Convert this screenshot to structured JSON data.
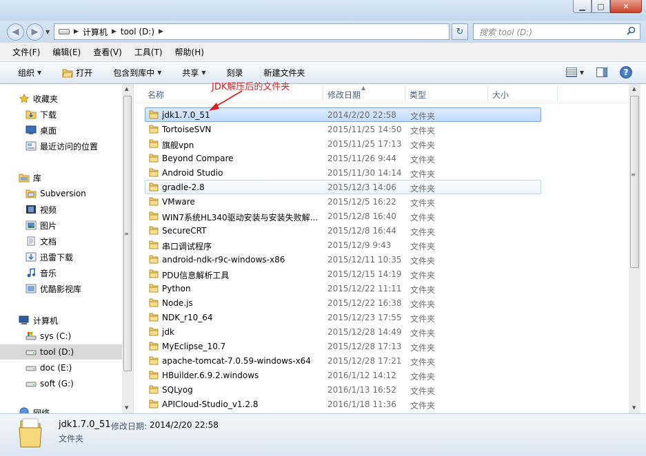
{
  "window": {
    "minimize_glyph": "▁",
    "maximize_glyph": "□",
    "close_glyph": "✕"
  },
  "address": {
    "back_glyph": "◀",
    "forward_glyph": "▶",
    "dropdown_glyph": "▼",
    "refresh_glyph": "↻",
    "breadcrumbs": [
      "计算机",
      "tool (D:)"
    ],
    "separator": "▶",
    "search_placeholder": "搜索 tool (D:)",
    "search_icon": "search-icon"
  },
  "menu": {
    "items": [
      "文件(F)",
      "编辑(E)",
      "查看(V)",
      "工具(T)",
      "帮助(H)"
    ]
  },
  "toolbar": {
    "organize": "组织",
    "open": "打开",
    "include_library": "包含到库中",
    "share": "共享",
    "burn": "刻录",
    "new_folder": "新建文件夹",
    "caret": "▼",
    "help_glyph": "?"
  },
  "nav": {
    "favorites": "收藏夹",
    "downloads": "下载",
    "desktop": "桌面",
    "recent": "最近访问的位置",
    "library": "库",
    "subversion": "Subversion",
    "videos": "视频",
    "pictures": "图片",
    "documents": "文档",
    "xunlei": "迅雷下载",
    "music": "音乐",
    "youku": "优酷影视库",
    "computer": "计算机",
    "drive_c": "sys (C:)",
    "drive_d": "tool (D:)",
    "drive_e": "doc (E:)",
    "drive_g": "soft (G:)",
    "network": "网络"
  },
  "columns": {
    "name": "名称",
    "date": "修改日期",
    "type": "类型",
    "size": "大小"
  },
  "files": [
    {
      "name": "jdk1.7.0_51",
      "date": "2014/2/20 22:58",
      "type": "文件夹",
      "state": "selected"
    },
    {
      "name": "TortoiseSVN",
      "date": "2015/11/25 14:50",
      "type": "文件夹",
      "state": ""
    },
    {
      "name": "旗舰vpn",
      "date": "2015/11/25 17:13",
      "type": "文件夹",
      "state": ""
    },
    {
      "name": "Beyond Compare",
      "date": "2015/11/26 9:44",
      "type": "文件夹",
      "state": ""
    },
    {
      "name": "Android Studio",
      "date": "2015/11/30 14:14",
      "type": "文件夹",
      "state": ""
    },
    {
      "name": "gradle-2.8",
      "date": "2015/12/3 14:06",
      "type": "文件夹",
      "state": "hover"
    },
    {
      "name": "VMware",
      "date": "2015/12/5 16:22",
      "type": "文件夹",
      "state": ""
    },
    {
      "name": "WIN7系统HL340驱动安装与安装失败解...",
      "date": "2015/12/8 16:40",
      "type": "文件夹",
      "state": ""
    },
    {
      "name": "SecureCRT",
      "date": "2015/12/8 16:44",
      "type": "文件夹",
      "state": ""
    },
    {
      "name": "串口调试程序",
      "date": "2015/12/9 9:43",
      "type": "文件夹",
      "state": ""
    },
    {
      "name": "android-ndk-r9c-windows-x86",
      "date": "2015/12/11 10:35",
      "type": "文件夹",
      "state": ""
    },
    {
      "name": "PDU信息解析工具",
      "date": "2015/12/15 14:19",
      "type": "文件夹",
      "state": ""
    },
    {
      "name": "Python",
      "date": "2015/12/22 11:11",
      "type": "文件夹",
      "state": ""
    },
    {
      "name": "Node.js",
      "date": "2015/12/22 16:38",
      "type": "文件夹",
      "state": ""
    },
    {
      "name": "NDK_r10_64",
      "date": "2015/12/23 17:55",
      "type": "文件夹",
      "state": ""
    },
    {
      "name": "jdk",
      "date": "2015/12/28 14:49",
      "type": "文件夹",
      "state": ""
    },
    {
      "name": "MyEclipse_10.7",
      "date": "2015/12/28 17:13",
      "type": "文件夹",
      "state": ""
    },
    {
      "name": "apache-tomcat-7.0.59-windows-x64",
      "date": "2015/12/28 17:21",
      "type": "文件夹",
      "state": ""
    },
    {
      "name": "HBuilder.6.9.2.windows",
      "date": "2016/1/12 14:12",
      "type": "文件夹",
      "state": ""
    },
    {
      "name": "SQLyog",
      "date": "2016/1/13 16:52",
      "type": "文件夹",
      "state": ""
    },
    {
      "name": "APICloud-Studio_v1.2.8",
      "date": "2016/1/18 11:36",
      "type": "文件夹",
      "state": ""
    }
  ],
  "annotation": {
    "text": "JDK解压后的文件夹",
    "color": "#e21b1b"
  },
  "details": {
    "name": "jdk1.7.0_51",
    "date_label": "修改日期:",
    "date_value": "2014/2/20 22:58",
    "type": "文件夹"
  },
  "colors": {
    "folder": "#f3cf6a",
    "selection": "#cde3fc",
    "accent": "#1f4f9a"
  }
}
